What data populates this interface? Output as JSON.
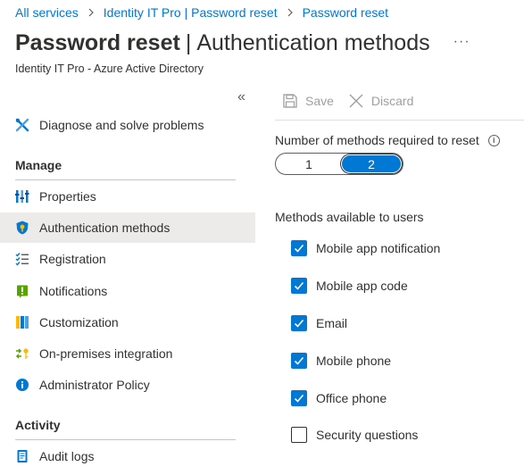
{
  "breadcrumb": {
    "items": [
      "All services",
      "Identity IT Pro | Password reset",
      "Password reset"
    ]
  },
  "header": {
    "title_strong": "Password reset",
    "title_separator": "|",
    "title_rest": "Authentication methods",
    "more_label": "···",
    "subtitle": "Identity IT Pro - Azure Active Directory"
  },
  "sidebar": {
    "collapse_label": "«",
    "diagnose": {
      "label": "Diagnose and solve problems",
      "icon": "wrench-cross-icon"
    },
    "manage_heading": "Manage",
    "manage_items": [
      {
        "label": "Properties",
        "icon": "properties-icon",
        "active": false
      },
      {
        "label": "Authentication methods",
        "icon": "shield-icon",
        "active": true
      },
      {
        "label": "Registration",
        "icon": "checklist-icon",
        "active": false
      },
      {
        "label": "Notifications",
        "icon": "notification-icon",
        "active": false
      },
      {
        "label": "Customization",
        "icon": "customization-icon",
        "active": false
      },
      {
        "label": "On-premises integration",
        "icon": "sync-key-icon",
        "active": false
      },
      {
        "label": "Administrator Policy",
        "icon": "info-circle-icon",
        "active": false
      }
    ],
    "activity_heading": "Activity",
    "activity_items": [
      {
        "label": "Audit logs",
        "icon": "audit-log-icon"
      }
    ]
  },
  "toolbar": {
    "save_label": "Save",
    "discard_label": "Discard"
  },
  "form": {
    "required_label": "Number of methods required to reset",
    "required_options": [
      "1",
      "2"
    ],
    "required_selected": "2",
    "methods_label": "Methods available to users",
    "methods": [
      {
        "label": "Mobile app notification",
        "checked": true
      },
      {
        "label": "Mobile app code",
        "checked": true
      },
      {
        "label": "Email",
        "checked": true
      },
      {
        "label": "Mobile phone",
        "checked": true
      },
      {
        "label": "Office phone",
        "checked": true
      },
      {
        "label": "Security questions",
        "checked": false
      }
    ]
  },
  "colors": {
    "accent": "#0078d4",
    "selected_nav_bg": "#edebe9",
    "disabled_text": "#a19f9d"
  }
}
